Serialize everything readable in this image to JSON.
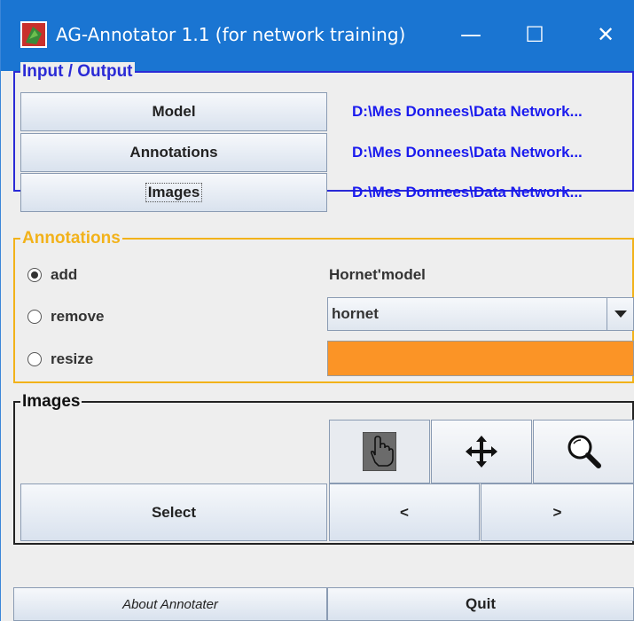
{
  "window": {
    "title": "AG-Annotator 1.1 (for network training)",
    "minimize_glyph": "—",
    "maximize_glyph": "☐",
    "close_glyph": "✕"
  },
  "io_group": {
    "legend": "Input / Output",
    "border_color": "#2a2ad6",
    "model_button": "Model",
    "model_path": "D:\\Mes Donnees\\Data Network...",
    "annotations_button": "Annotations",
    "annotations_path": "D:\\Mes Donnees\\Data Network...",
    "images_button": "Images",
    "images_path": "D:\\Mes Donnees\\Data Network..."
  },
  "annotations_group": {
    "legend": "Annotations",
    "legend_color": "#f2b21a",
    "modes": [
      {
        "label": "add",
        "selected": true
      },
      {
        "label": "remove",
        "selected": false
      },
      {
        "label": "resize",
        "selected": false
      }
    ],
    "model_label": "Hornet'model",
    "class_select_value": "hornet",
    "class_color": "#fb9426"
  },
  "images_group": {
    "legend": "Images",
    "tools": [
      {
        "icon": "hand-pointer-icon",
        "active": true
      },
      {
        "icon": "move-arrows-icon",
        "active": false
      },
      {
        "icon": "magnifier-icon",
        "active": false
      }
    ],
    "select_button": "Select",
    "prev_button": "<",
    "next_button": ">"
  },
  "footer": {
    "about_button": "About Annotater",
    "quit_button": "Quit"
  }
}
